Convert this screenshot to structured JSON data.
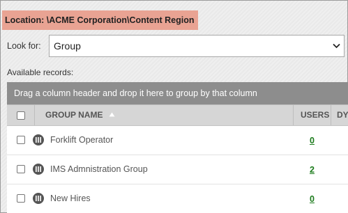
{
  "location": {
    "text": "Location: \\ACME Corporation\\Content Region"
  },
  "look_for": {
    "label": "Look for:",
    "value": "Group"
  },
  "available": {
    "label": "Available records:"
  },
  "grid": {
    "group_hint": "Drag a column header and drop it here to group by that column",
    "columns": {
      "group_name": "GROUP NAME",
      "users": "USERS",
      "partial": "DY"
    },
    "rows": [
      {
        "name": "Forklift Operator",
        "users": "0"
      },
      {
        "name": "IMS Admnistration Group",
        "users": "2"
      },
      {
        "name": "New Hires",
        "users": "0"
      }
    ]
  },
  "colors": {
    "location_bg": "#e9a393",
    "link": "#1a7a1a",
    "group_bar": "#8d8d8d"
  }
}
